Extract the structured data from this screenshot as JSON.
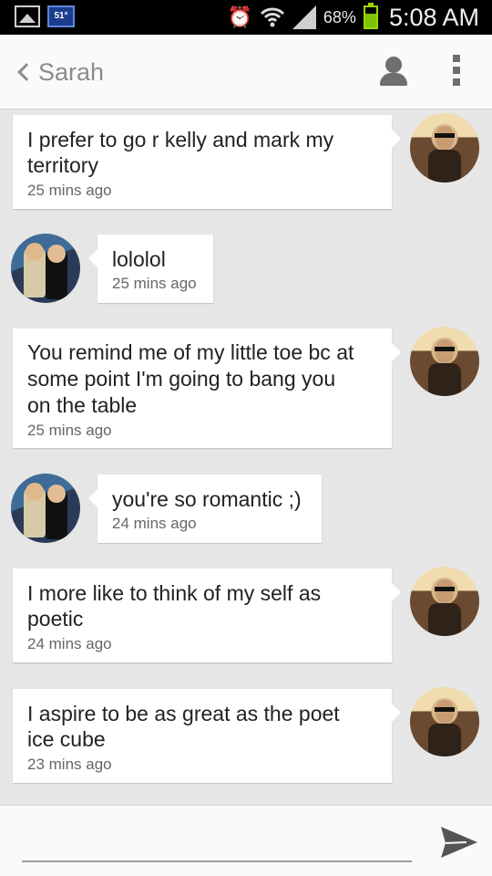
{
  "status_bar": {
    "weather_temp": "51°",
    "battery_percent": "68%",
    "battery_level": 0.68,
    "time": "5:08 AM",
    "icons": [
      "gallery-icon",
      "weather-icon",
      "alarm-icon",
      "wifi-icon",
      "signal-icon",
      "battery-icon"
    ]
  },
  "header": {
    "back_icon": "chevron-left-icon",
    "contact_name": "Sarah",
    "profile_icon": "person-icon",
    "menu_icon": "overflow-menu-icon"
  },
  "messages": [
    {
      "sender": "me",
      "text_lines": [
        "I prefer to go r kelly and mark my",
        "territory"
      ],
      "time": "25 mins ago"
    },
    {
      "sender": "them",
      "text_lines": [
        "lololol"
      ],
      "time": "25 mins ago"
    },
    {
      "sender": "me",
      "text_lines": [
        "You remind me of my little toe bc at",
        "some point I'm going to bang you",
        "on the table"
      ],
      "time": "25 mins ago"
    },
    {
      "sender": "them",
      "text_lines": [
        "you're so romantic ;)"
      ],
      "time": "24 mins ago"
    },
    {
      "sender": "me",
      "text_lines": [
        "I more like to think of my self as",
        "poetic"
      ],
      "time": "24 mins ago"
    },
    {
      "sender": "me",
      "text_lines": [
        "I aspire to be as great as the poet",
        "ice cube"
      ],
      "time": "23 mins ago"
    }
  ],
  "compose": {
    "value": "",
    "placeholder": "",
    "send_icon": "send-icon"
  },
  "colors": {
    "background": "#e6e6e6",
    "bubble": "#ffffff",
    "header": "#fafafa",
    "battery": "#7ec400"
  }
}
